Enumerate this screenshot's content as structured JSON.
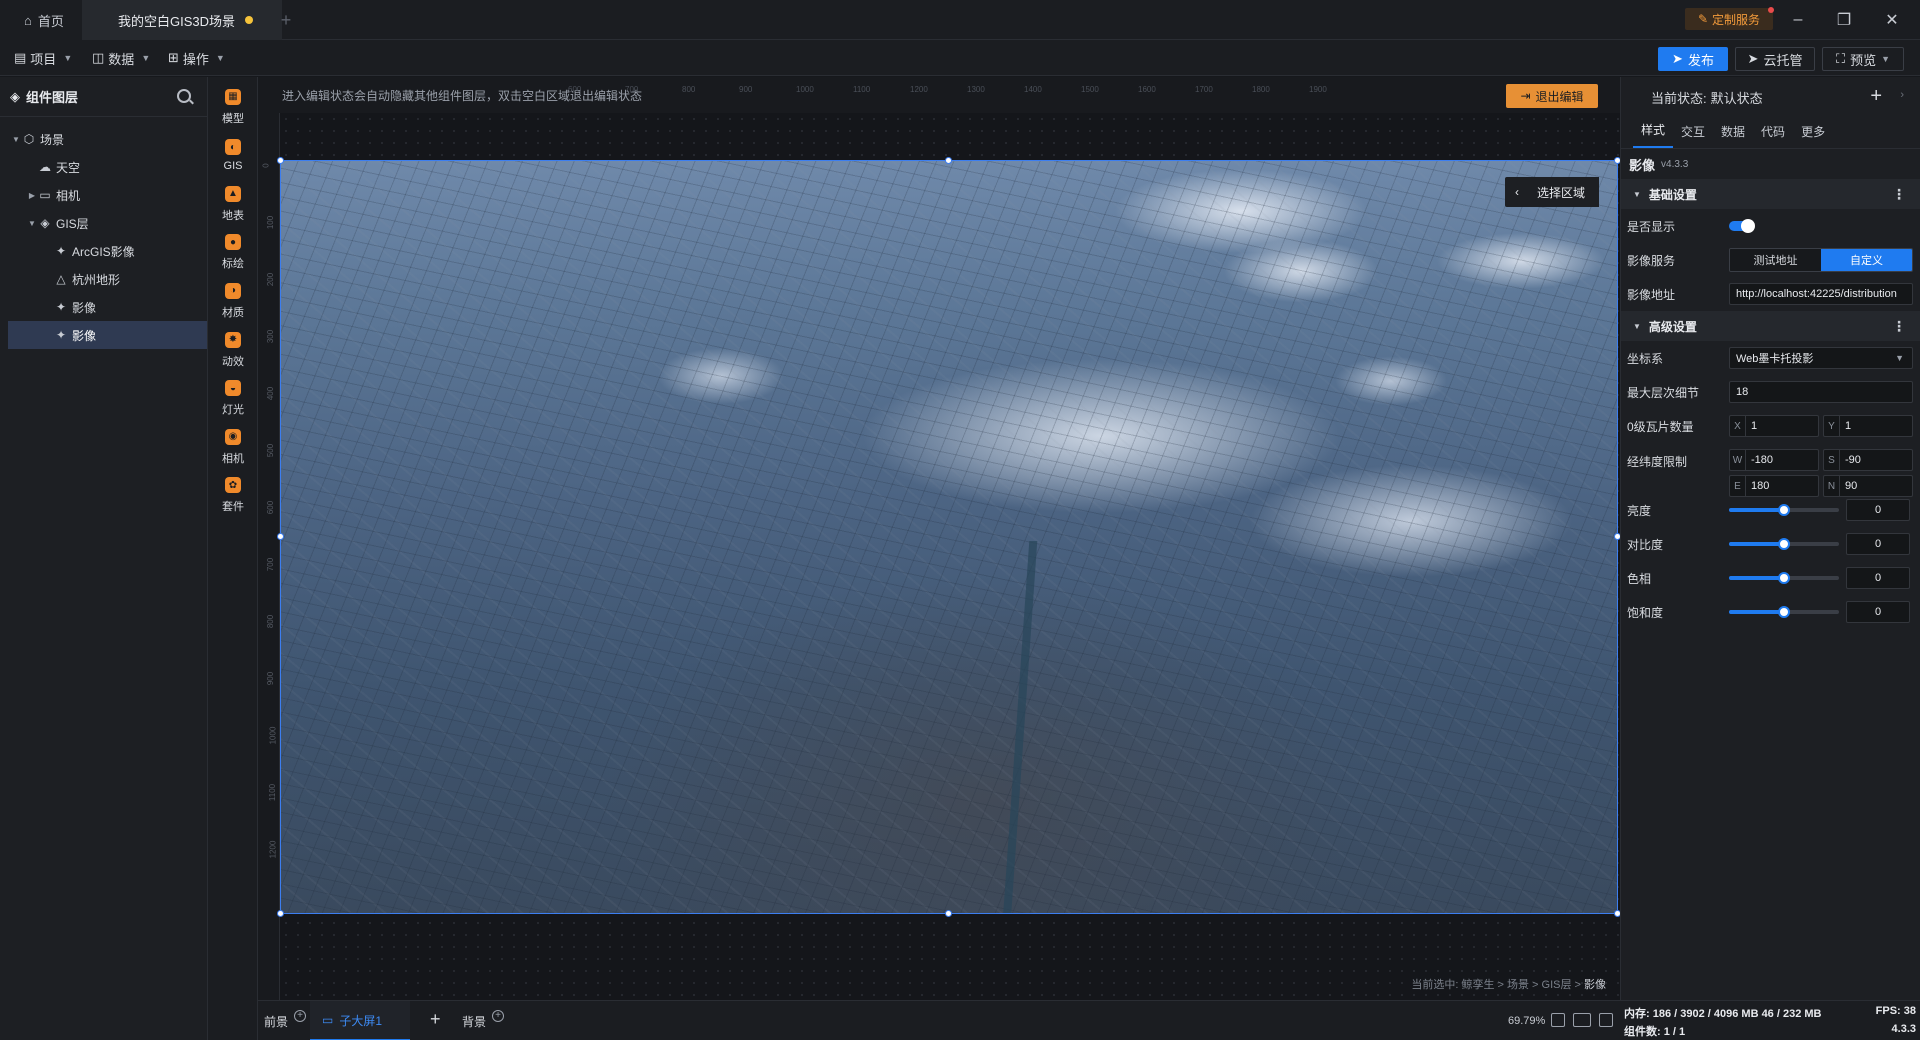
{
  "titlebar": {
    "home_label": "首页",
    "project_tab": "我的空白GIS3D场景",
    "custom_service": "定制服务"
  },
  "menubar": {
    "items": [
      {
        "label": "项目",
        "icon": "file-icon"
      },
      {
        "label": "数据",
        "icon": "database-icon"
      },
      {
        "label": "操作",
        "icon": "grid-icon"
      }
    ],
    "publish": "发布",
    "cloud": "云托管",
    "preview": "预览"
  },
  "left_panel": {
    "title": "组件图层",
    "tree": [
      {
        "label": "场景",
        "icon": "scene-icon",
        "depth": 0,
        "arrow": "expanded"
      },
      {
        "label": "天空",
        "icon": "sky-icon",
        "depth": 1,
        "arrow": ""
      },
      {
        "label": "相机",
        "icon": "folder-icon",
        "depth": 1,
        "arrow": "collapsed"
      },
      {
        "label": "GIS层",
        "icon": "layers-icon",
        "depth": 1,
        "arrow": "expanded"
      },
      {
        "label": "ArcGIS影像",
        "icon": "satellite-icon",
        "depth": 2,
        "arrow": ""
      },
      {
        "label": "杭州地形",
        "icon": "terrain-icon",
        "depth": 2,
        "arrow": ""
      },
      {
        "label": "影像",
        "icon": "satellite-icon",
        "depth": 2,
        "arrow": ""
      },
      {
        "label": "影像",
        "icon": "satellite-icon",
        "depth": 2,
        "arrow": "",
        "selected": true
      }
    ]
  },
  "components": [
    {
      "label": "模型",
      "icon": "model-icon"
    },
    {
      "label": "GIS",
      "icon": "globe-icon"
    },
    {
      "label": "地表",
      "icon": "surface-icon"
    },
    {
      "label": "标绘",
      "icon": "pin-icon"
    },
    {
      "label": "材质",
      "icon": "material-icon"
    },
    {
      "label": "动效",
      "icon": "effect-icon"
    },
    {
      "label": "灯光",
      "icon": "light-icon"
    },
    {
      "label": "相机",
      "icon": "camera-icon"
    },
    {
      "label": "套件",
      "icon": "kit-icon"
    }
  ],
  "canvas": {
    "hint": "进入编辑状态会自动隐藏其他组件图层，双击空白区域退出编辑状态",
    "exit_edit": "退出编辑",
    "select_area": "选择区域",
    "breadcrumb_prefix": "当前选中: 鲸孪生 > 场景 > GIS层 > ",
    "breadcrumb_current": "影像",
    "ruler_top": [
      "600",
      "700",
      "800",
      "900",
      "1000",
      "1100",
      "1200",
      "1300",
      "1400",
      "1500",
      "1600",
      "1700",
      "1800",
      "1900"
    ],
    "ruler_left": [
      "0",
      "100",
      "200",
      "300",
      "400",
      "500",
      "600",
      "700",
      "800",
      "900",
      "1000",
      "1100",
      "1200"
    ]
  },
  "bottombar": {
    "foreground": "前景",
    "active_tab": "子大屏1",
    "background": "背景",
    "zoom": "69.79%"
  },
  "right_panel": {
    "state_label": "当前状态: ",
    "state_value": "默认状态",
    "tabs": [
      "样式",
      "交互",
      "数据",
      "代码",
      "更多"
    ],
    "component_title": "影像",
    "component_version": "v4.3.3",
    "basic_section": "基础设置",
    "advanced_section": "高级设置",
    "visible_label": "是否显示",
    "visible": true,
    "service_label": "影像服务",
    "service_options": [
      "测试地址",
      "自定义"
    ],
    "service_selected": "自定义",
    "url_label": "影像地址",
    "url_value": "http://localhost:42225/distribution",
    "crs_label": "坐标系",
    "crs_value": "Web墨卡托投影",
    "maxlevel_label": "最大层次细节",
    "maxlevel_value": "18",
    "tiles_label": "0级瓦片数量",
    "tiles_x": "1",
    "tiles_y": "1",
    "bounds_label": "经纬度限制",
    "bounds": {
      "W": "-180",
      "S": "-90",
      "E": "180",
      "N": "90"
    },
    "sliders": [
      {
        "label": "亮度",
        "value": "0",
        "level": 0.5
      },
      {
        "label": "对比度",
        "value": "0",
        "level": 0.5
      },
      {
        "label": "色相",
        "value": "0",
        "level": 0.5
      },
      {
        "label": "饱和度",
        "value": "0",
        "level": 0.5
      }
    ]
  },
  "status": {
    "memory": "内存: 186 / 3902 / 4096 MB  46 / 232 MB",
    "fps": "FPS: 38",
    "components": "组件数: 1 / 1",
    "version": "4.3.3"
  },
  "colors": {
    "accent": "#1f7bf0",
    "exit_button": "#e79035",
    "unsaved_dot": "#f5c33b"
  }
}
